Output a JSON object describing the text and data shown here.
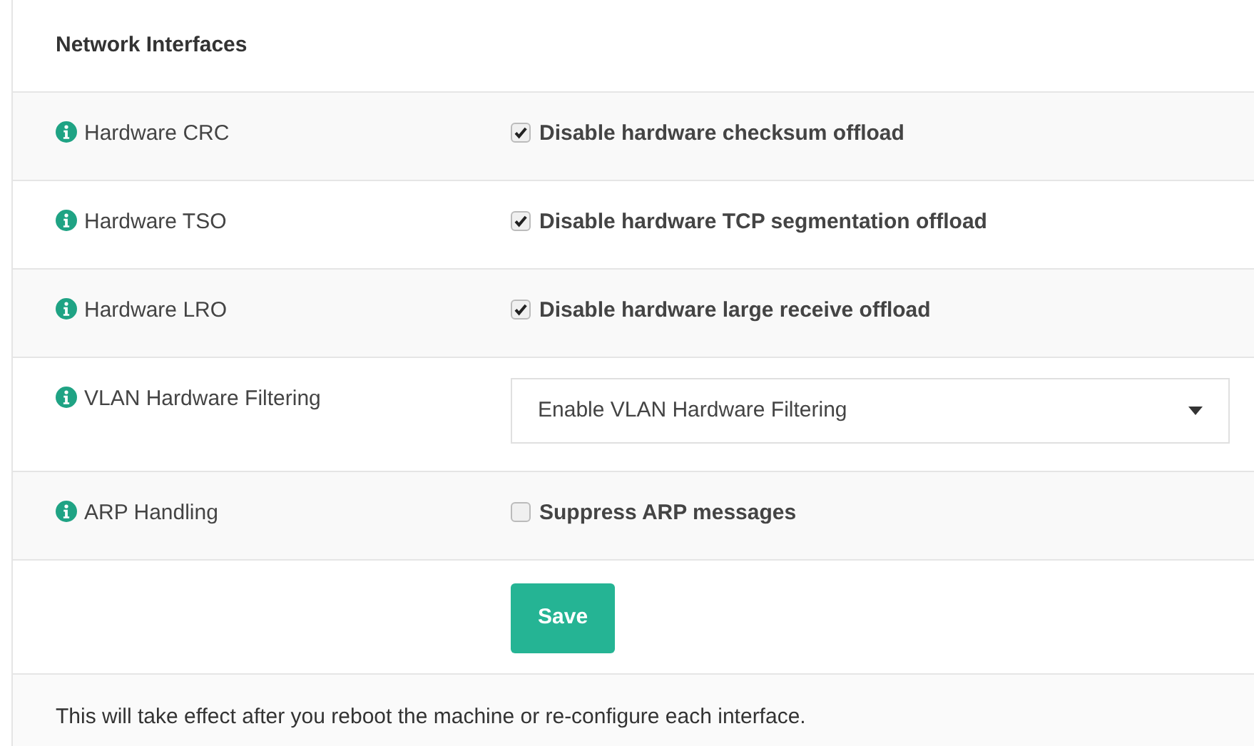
{
  "panel": {
    "title": "Network Interfaces"
  },
  "rows": [
    {
      "kind": "checkbox",
      "label": "Hardware CRC",
      "text": "Disable hardware checksum offload",
      "checked": true
    },
    {
      "kind": "checkbox",
      "label": "Hardware TSO",
      "text": "Disable hardware TCP segmentation offload",
      "checked": true
    },
    {
      "kind": "checkbox",
      "label": "Hardware LRO",
      "text": "Disable hardware large receive offload",
      "checked": true
    },
    {
      "kind": "select",
      "label": "VLAN Hardware Filtering",
      "value": "Enable VLAN Hardware Filtering"
    },
    {
      "kind": "checkbox",
      "label": "ARP Handling",
      "text": "Suppress ARP messages",
      "checked": false
    }
  ],
  "save_button": "Save",
  "footer": "This will take effect after you reboot the machine or re-configure each interface."
}
